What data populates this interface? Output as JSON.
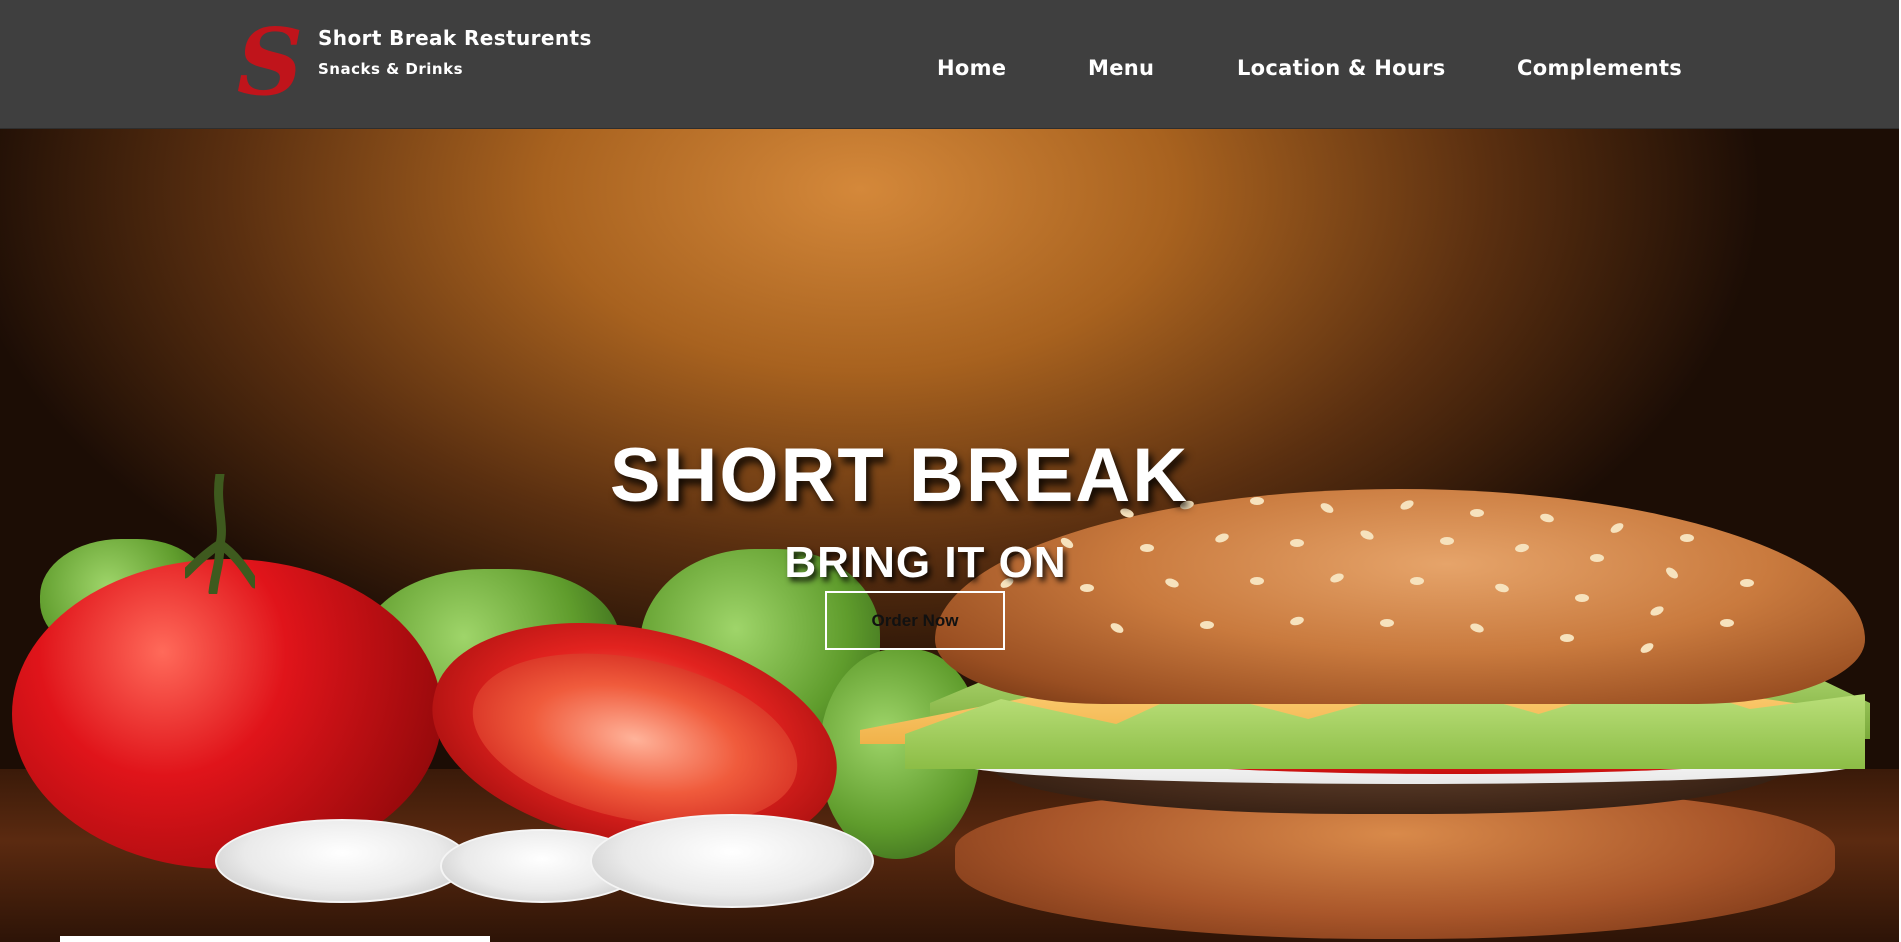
{
  "brand": {
    "logo_letter": "S",
    "name": "Short Break Resturents",
    "tagline": "Snacks & Drinks"
  },
  "nav": {
    "items": [
      {
        "label": "Home"
      },
      {
        "label": "Menu"
      },
      {
        "label": "Location & Hours"
      },
      {
        "label": "Complements"
      }
    ]
  },
  "hero": {
    "title": "SHORT BREAK",
    "subtitle": "BRING IT ON",
    "cta_label": "Order Now",
    "background_image": "burger-tomato-photo"
  },
  "colors": {
    "navbar": "#3f3f3f",
    "logo_red": "#c0141b",
    "text_white": "#ffffff"
  }
}
